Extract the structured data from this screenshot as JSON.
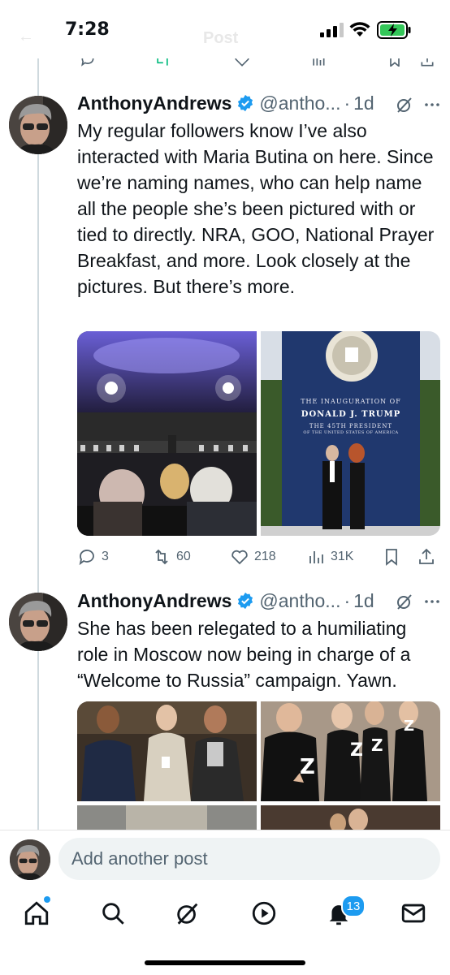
{
  "status_bar": {
    "time": "7:28",
    "ghost_title": "Post",
    "battery": "charging"
  },
  "tweets": [
    {
      "name": "AnthonyAndrews",
      "handle": "@antho...",
      "separator": "·",
      "time": "1d",
      "text": "My regular followers know I’ve also interacted with Maria Butina on here. Since we’re naming names, who can help name all the people she’s been pictured with or tied to directly. NRA, GOO, National Prayer Breakfast, and more. Look closely at the pictures. But there’s more.",
      "image_texts": {
        "banner_line1": "THE INAUGURATION OF",
        "banner_line2": "DONALD J. TRUMP",
        "banner_line3": "THE 45TH PRESIDENT",
        "banner_line4": "OF THE UNITED STATES OF AMERICA"
      },
      "actions": {
        "replies": "3",
        "reposts": "60",
        "likes": "218",
        "views": "31K"
      }
    },
    {
      "name": "AnthonyAndrews",
      "handle": "@antho...",
      "separator": "·",
      "time": "1d",
      "text": "She has been relegated to a humiliating role in Moscow now being in charge of a “Welcome to Russia” campaign. Yawn.",
      "shirt_letter": "Z"
    }
  ],
  "compose": {
    "placeholder": "Add another post"
  },
  "tabbar": {
    "notifications_badge": "13"
  },
  "colors": {
    "accent": "#1d9bf0",
    "text": "#0f1419",
    "secondary": "#536471",
    "verified": "#1d9bf0"
  }
}
